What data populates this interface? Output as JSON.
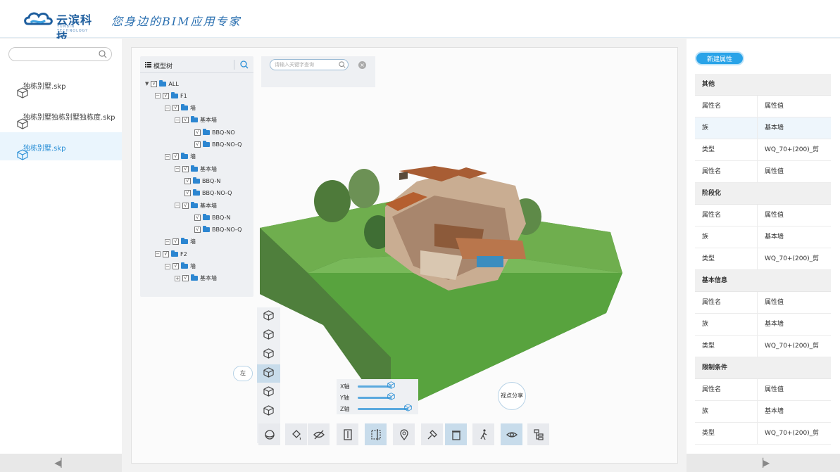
{
  "brand": {
    "name": "云滨科技",
    "sub": "YUNBIN TECHNOLOGY",
    "slogan": "您身边的BIM应用专家",
    "accent": "#29a3e8"
  },
  "files": [
    {
      "label": "独栋别墅.skp",
      "active": false
    },
    {
      "label": "独栋别墅独栋别墅独栋度.skp",
      "active": false
    },
    {
      "label": "独栋别墅.skp",
      "active": true
    }
  ],
  "tree": {
    "title": "模型树",
    "nodes": [
      {
        "label": "ALL",
        "depth": 0,
        "type": "root"
      },
      {
        "label": "F1",
        "depth": 1
      },
      {
        "label": "墙",
        "depth": 2
      },
      {
        "label": "基本墙",
        "depth": 3
      },
      {
        "label": "BBQ-NO",
        "depth": 4,
        "leaf": true
      },
      {
        "label": "BBQ-NO-Q",
        "depth": 4,
        "leaf": true
      },
      {
        "label": "墙",
        "depth": 2
      },
      {
        "label": "基本墙",
        "depth": 3
      },
      {
        "label": "BBQ-N",
        "depth": 3,
        "leaf": true
      },
      {
        "label": "BBQ-NO-Q",
        "depth": 3,
        "leaf": true
      },
      {
        "label": "基本墙",
        "depth": 3
      },
      {
        "label": "BBQ-N",
        "depth": 4,
        "leaf": true
      },
      {
        "label": "BBQ-NO-Q",
        "depth": 4,
        "leaf": true
      },
      {
        "label": "墙",
        "depth": 2
      },
      {
        "label": "F2",
        "depth": 1
      },
      {
        "label": "墙",
        "depth": 2
      },
      {
        "label": "基本墙",
        "depth": 3,
        "plus": true
      }
    ]
  },
  "keyword": {
    "placeholder": "请输入关键字查询"
  },
  "view_tip": "左",
  "axes": [
    {
      "label": "X轴",
      "value": 0.6
    },
    {
      "label": "Y轴",
      "value": 0.6
    },
    {
      "label": "Z轴",
      "value": 0.9
    }
  ],
  "share_label": "视点分享",
  "tools": [
    "rotate-icon",
    "hide-icon",
    "eye-slash-icon",
    "section-icon",
    "box-select-icon",
    "location-icon",
    "pin-icon",
    "paint-icon",
    "walk-icon",
    "view-icon",
    "tree-icon"
  ],
  "new_prop_label": "新建属性",
  "properties": [
    {
      "section": "其他",
      "rows": [
        [
          "属性名",
          "属性值"
        ],
        [
          "族",
          "基本墙"
        ],
        [
          "类型",
          "WQ_70+(200)_剪"
        ],
        [
          "属性名",
          "属性值"
        ]
      ]
    },
    {
      "section": "阶段化",
      "rows": [
        [
          "属性名",
          "属性值"
        ],
        [
          "族",
          "基本墙"
        ],
        [
          "类型",
          "WQ_70+(200)_剪"
        ]
      ]
    },
    {
      "section": "基本信息",
      "rows": [
        [
          "属性名",
          "属性值"
        ],
        [
          "族",
          "基本墙"
        ],
        [
          "类型",
          "WQ_70+(200)_剪"
        ]
      ]
    },
    {
      "section": "限制条件",
      "rows": [
        [
          "属性名",
          "属性值"
        ],
        [
          "族",
          "基本墙"
        ],
        [
          "类型",
          "WQ_70+(200)_剪"
        ]
      ]
    }
  ]
}
